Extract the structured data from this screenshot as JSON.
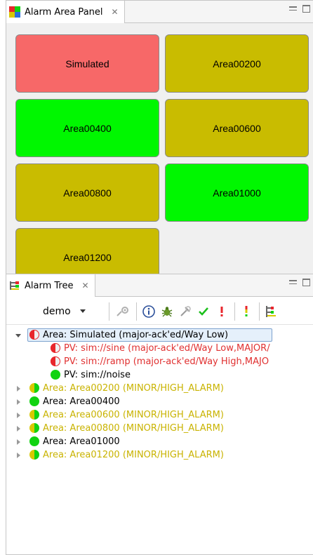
{
  "area_panel": {
    "tab_title": "Alarm Area Panel",
    "buttons": [
      {
        "label": "Simulated",
        "color": "#f76868"
      },
      {
        "label": "Area00200",
        "color": "#c9bc00"
      },
      {
        "label": "Area00400",
        "color": "#00f700"
      },
      {
        "label": "Area00600",
        "color": "#c9bc00"
      },
      {
        "label": "Area00800",
        "color": "#c9bc00"
      },
      {
        "label": "Area01000",
        "color": "#00f700"
      },
      {
        "label": "Area01200",
        "color": "#c9bc00"
      }
    ]
  },
  "alarm_tree": {
    "tab_title": "Alarm Tree",
    "toolbar": {
      "config_value": "demo",
      "icons": [
        "search-pv-icon",
        "info-icon",
        "bug-icon",
        "guidance-icon",
        "acknowledge-icon",
        "unacknowledge-icon",
        "maximize-severity-icon",
        "tree-layout-icon"
      ]
    },
    "rows": [
      {
        "text": "Area: Simulated (major-ack'ed/Way Low)",
        "color": "#000000",
        "state": "major-acked",
        "expanded": true
      },
      {
        "text": "PV: sim://sine (major-ack'ed/Way Low,MAJOR/",
        "color": "#e03030",
        "state": "major-acked"
      },
      {
        "text": "PV: sim://ramp (major-ack'ed/Way High,MAJO",
        "color": "#e03030",
        "state": "major-acked"
      },
      {
        "text": "PV: sim://noise",
        "color": "#000000",
        "state": "ok"
      },
      {
        "text": "Area: Area00200 (MINOR/HIGH_ALARM)",
        "color": "#c9b300",
        "state": "minor",
        "expanded": false
      },
      {
        "text": "Area: Area00400",
        "color": "#000000",
        "state": "ok",
        "expanded": false
      },
      {
        "text": "Area: Area00600 (MINOR/HIGH_ALARM)",
        "color": "#c9b300",
        "state": "minor",
        "expanded": false
      },
      {
        "text": "Area: Area00800 (MINOR/HIGH_ALARM)",
        "color": "#c9b300",
        "state": "minor",
        "expanded": false
      },
      {
        "text": "Area: Area01000",
        "color": "#000000",
        "state": "ok",
        "expanded": false
      },
      {
        "text": "Area: Area01200 (MINOR/HIGH_ALARM)",
        "color": "#c9b300",
        "state": "minor",
        "expanded": false
      }
    ]
  },
  "colors": {
    "major": "#e8262c",
    "minor": "#d9c800",
    "ok": "#11d311",
    "major_acked_half": "#f0f0f0"
  }
}
